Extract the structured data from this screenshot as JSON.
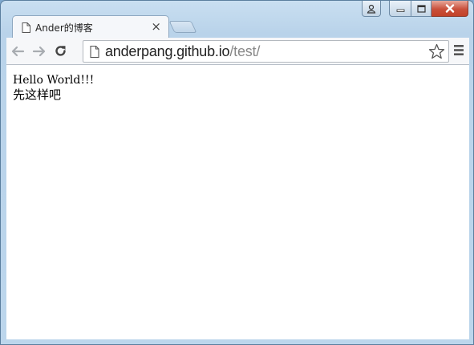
{
  "window": {
    "user_icon": "user-icon",
    "minimize_icon": "minimize-icon",
    "maximize_icon": "maximize-icon",
    "close_icon": "close-icon"
  },
  "tab": {
    "title": "Ander的博客",
    "page_icon": "page-icon",
    "close_label": "×"
  },
  "toolbar": {
    "back_icon": "back-arrow-icon",
    "forward_icon": "forward-arrow-icon",
    "reload_icon": "reload-icon",
    "url_host": "anderpang.github.io",
    "url_path": "/test/",
    "star_icon": "star-icon",
    "menu_icon": "menu-icon"
  },
  "content": {
    "line1": "Hello World!!!",
    "line2": "先这样吧"
  },
  "colors": {
    "frame": "#bcd6ec",
    "close_button": "#c9503b",
    "url_host": "#222222",
    "url_path": "#888888"
  }
}
